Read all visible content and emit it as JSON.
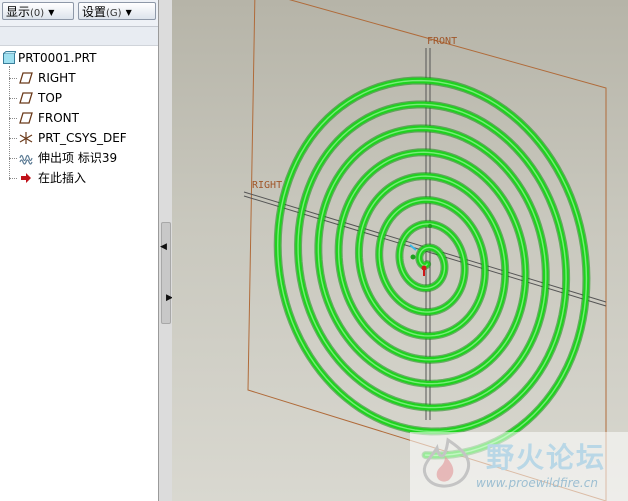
{
  "toolbar": {
    "show_label": "显示",
    "show_shortcut": "(0)",
    "settings_label": "设置",
    "settings_shortcut": "(G)"
  },
  "tree": {
    "root": "PRT0001.PRT",
    "items": [
      {
        "label": "RIGHT",
        "icon": "datum-plane-icon"
      },
      {
        "label": "TOP",
        "icon": "datum-plane-icon"
      },
      {
        "label": "FRONT",
        "icon": "datum-plane-icon"
      },
      {
        "label": "PRT_CSYS_DEF",
        "icon": "coordinate-system-icon"
      },
      {
        "label": "伸出项 标识39",
        "icon": "sweep-feature-icon"
      },
      {
        "label": "在此插入",
        "icon": "insert-here-arrow-icon"
      }
    ]
  },
  "viewport": {
    "plane_labels": {
      "front": "FRONT",
      "right": "RIGHT"
    },
    "spiral_color": "#1fd21f",
    "plane_color": "#b06b3a"
  },
  "watermark": {
    "title": "野火论坛",
    "url": "www.proewildfire.cn"
  }
}
